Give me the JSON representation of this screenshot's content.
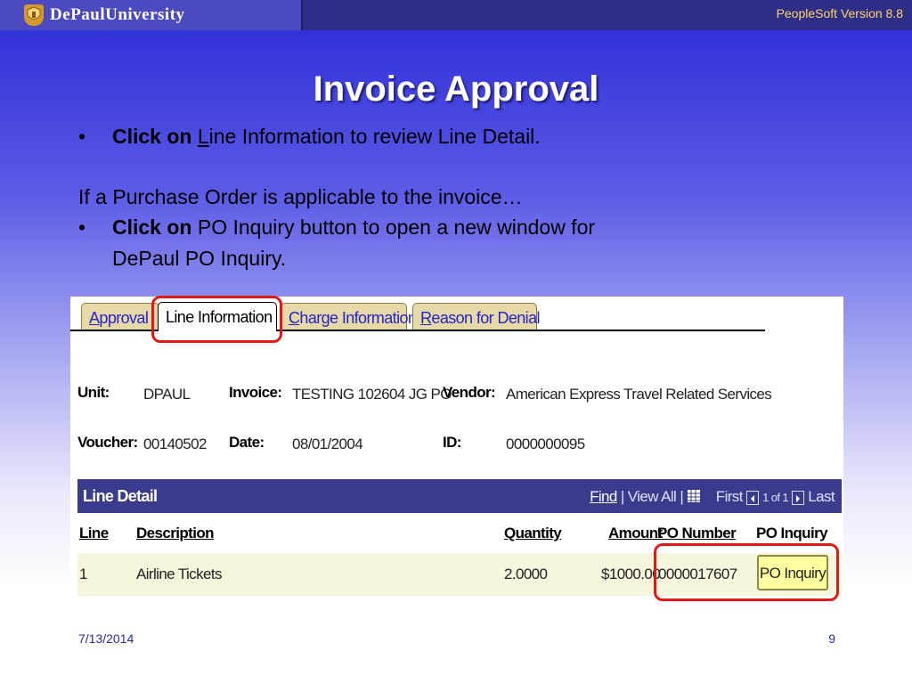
{
  "header": {
    "university": "DePaulUniversity",
    "version": "PeopleSoft Version 8.8"
  },
  "slide": {
    "title": "Invoice Approval",
    "bullet1_bold": "Click on",
    "bullet1_u": "L",
    "bullet1_rest": "ine Information to review Line Detail.",
    "condition": "If a Purchase Order is applicable to the invoice…",
    "bullet2_bold": "Click on",
    "bullet2_rest": "PO Inquiry button to open a new window for",
    "bullet2_line2": "DePaul PO Inquiry.",
    "bullet_glyph": "•"
  },
  "tabs": [
    {
      "u": "A",
      "rest": "pproval"
    },
    {
      "u": "",
      "rest": "Line Information"
    },
    {
      "u": "C",
      "rest": "harge Information"
    },
    {
      "u": "R",
      "rest": "eason for Denial"
    }
  ],
  "fields": {
    "unit_label": "Unit:",
    "unit_value": "DPAUL",
    "invoice_label": "Invoice:",
    "invoice_value": "TESTING 102604 JG PO",
    "vendor_label": "Vendor:",
    "vendor_value": "American Express Travel Related Services",
    "voucher_label": "Voucher:",
    "voucher_value": "00140502",
    "date_label": "Date:",
    "date_value": "08/01/2004",
    "id_label": "ID:",
    "id_value": "0000000095"
  },
  "grid": {
    "title": "Line Detail",
    "find": "Find",
    "view_all": "| View All |",
    "first": "First",
    "range": "1 of 1",
    "last": "Last",
    "columns": [
      "Line",
      "Description",
      "Quantity",
      "Amount",
      "PO Number",
      "PO Inquiry"
    ],
    "row": {
      "line": "1",
      "description": "Airline Tickets",
      "quantity": "2.0000",
      "amount": "$1000.00",
      "po_number": "0000017607",
      "button": "PO Inquiry"
    }
  },
  "footer": {
    "date": "7/13/2014",
    "page": "9"
  },
  "colors": {
    "highlight": "#e01818",
    "grid_header": "#3b3b8e",
    "tab": "#e7d9a7"
  }
}
